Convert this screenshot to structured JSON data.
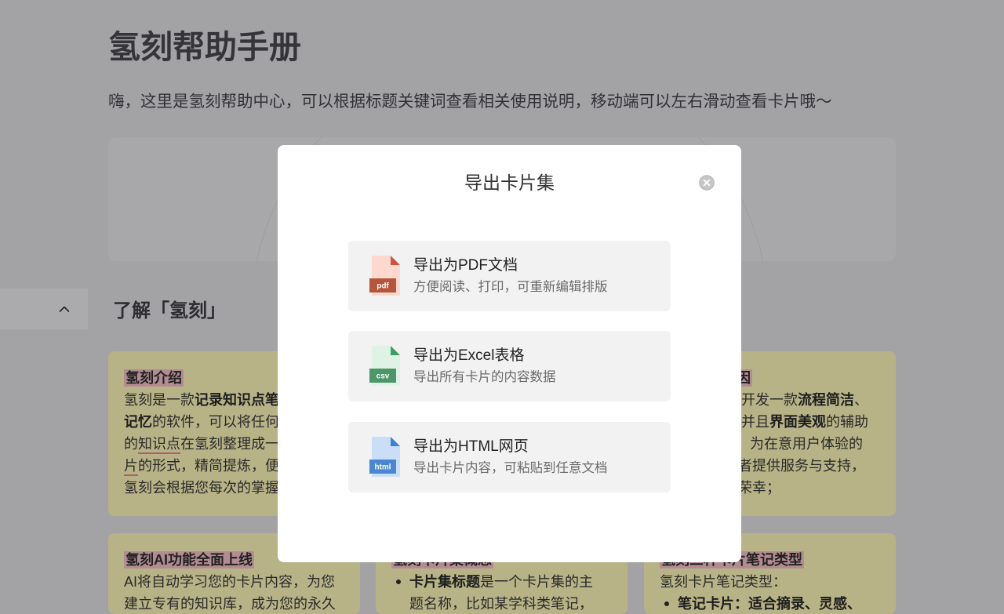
{
  "header": {
    "title": "氢刻帮助手册",
    "subtitle": "嗨，这里是氢刻帮助中心，可以根据标题关键词查看相关使用说明，移动端可以左右滑动查看卡片哦～"
  },
  "sidebar": {
    "collapse_icon": "chevron-up-icon"
  },
  "section": {
    "heading": "了解「氢刻」"
  },
  "cards": {
    "intro": {
      "title": "氢刻介绍",
      "lines": [
        [
          "氢刻是一款",
          "记录知识点笔"
        ],
        [
          "记忆",
          "的软件，可以将任何"
        ],
        [
          "的",
          "知识点",
          "在氢刻整理成一"
        ],
        [
          "片",
          "的形式，精简提炼，便"
        ],
        [
          "氢刻会根据您每次的掌握"
        ]
      ]
    },
    "reason": {
      "title": "因",
      "lines": [
        [
          "开发一款",
          "流程简洁",
          "、"
        ],
        [
          "并且",
          "界面美观",
          "的辅助"
        ],
        [
          "为在意用户体验的"
        ],
        [
          "者提供服务与支持，"
        ],
        [
          "荣幸；"
        ]
      ]
    },
    "ai": {
      "title": "氢刻AI功能全面上线",
      "lines": [
        "AI将自动学习您的卡片内容，为您",
        "建立专有的知识库，成为您的永久"
      ]
    },
    "card_set": {
      "title": "氢刻卡片集概念",
      "bullets": [
        {
          "bold": "卡片集标题",
          "text": [
            "是一个卡片集的主",
            "题名称，比如某学科类笔记，"
          ]
        }
      ]
    },
    "note_types": {
      "title": "氢刻三种卡片笔记类型",
      "intro": "氢刻卡片笔记类型：",
      "bullets": [
        {
          "bold": "笔记卡片：适合摘录、灵感、"
        }
      ]
    }
  },
  "modal": {
    "title": "导出卡片集",
    "close_icon": "close-icon",
    "options": [
      {
        "title": "导出为PDF文档",
        "description": "方便阅读、打印，可重新编辑排版",
        "icon": "pdf-file-icon",
        "icon_label": "pdf",
        "colors": {
          "page": "#fcd8cf",
          "fold": "#c9573e",
          "label": "#b4553c"
        }
      },
      {
        "title": "导出为Excel表格",
        "description": "导出所有卡片的内容数据",
        "icon": "csv-file-icon",
        "icon_label": "csv",
        "colors": {
          "page": "#def3e6",
          "fold": "#3e9d62",
          "label": "#4c966a"
        }
      },
      {
        "title": "导出为HTML网页",
        "description": "导出卡片内容，可粘贴到任意文档",
        "icon": "html-file-icon",
        "icon_label": "html",
        "colors": {
          "page": "#cbdef8",
          "fold": "#3b82d6",
          "label": "#4a87d0"
        }
      }
    ]
  },
  "theme": {
    "card_bg": "#fff8bb",
    "highlight_bg": "#f9c3cc",
    "underline": "#ee8496",
    "dialog_bg": "#ffffff",
    "option_bg": "#f2f2f2"
  }
}
